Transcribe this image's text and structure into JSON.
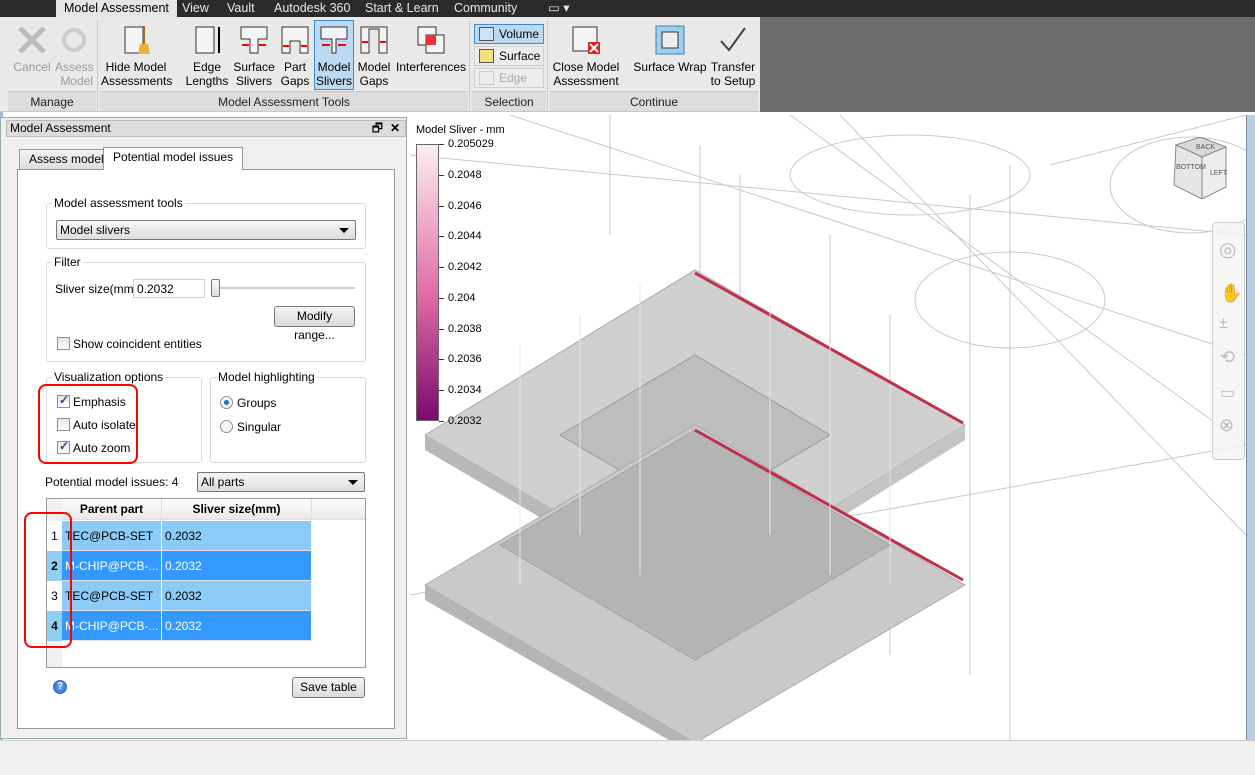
{
  "menubar": {
    "tabs": [
      "Model Assessment",
      "View",
      "Vault",
      "Autodesk 360",
      "Start & Learn",
      "Community"
    ],
    "active": "Model Assessment"
  },
  "ribbon": {
    "manage": {
      "label": "Manage",
      "cancel": "Cancel",
      "assess": [
        "Assess",
        "Model"
      ]
    },
    "tools": {
      "label": "Model Assessment Tools",
      "hide": [
        "Hide Model",
        "Assessments"
      ],
      "edge": [
        "Edge",
        "Lengths"
      ],
      "surface": [
        "Surface",
        "Slivers"
      ],
      "partgaps": [
        "Part",
        "Gaps"
      ],
      "slivers": [
        "Model",
        "Slivers"
      ],
      "modelgaps": [
        "Model",
        "Gaps"
      ],
      "interf": "Interferences"
    },
    "selection": {
      "label": "Selection",
      "volume": "Volume",
      "surface": "Surface",
      "edge": "Edge"
    },
    "cont": {
      "label": "Continue",
      "close": [
        "Close Model",
        "Assessment"
      ],
      "wrap": "Surface Wrap",
      "transfer": [
        "Transfer",
        "to Setup"
      ]
    }
  },
  "panel": {
    "title": "Model Assessment",
    "tabs": [
      "Assess model",
      "Potential model issues"
    ],
    "active_tab": "Potential model issues",
    "tools_group": "Model assessment tools",
    "tool_selected": "Model slivers",
    "filter_group": "Filter",
    "sliver_label": "Sliver size(mm)",
    "sliver_value": "0.2032",
    "slider_value_fraction": 0.0,
    "modify_range": "Modify range...",
    "show_coincident": "Show coincident entities",
    "show_coincident_checked": false,
    "vis_group": "Visualization options",
    "emphasis": "Emphasis",
    "emphasis_checked": true,
    "auto_isolate": "Auto isolate",
    "auto_isolate_checked": false,
    "auto_zoom": "Auto zoom",
    "auto_zoom_checked": true,
    "hl_group": "Model highlighting",
    "groups": "Groups",
    "singular": "Singular",
    "highlight_selected": "Groups",
    "issues_label": "Potential model issues: 4",
    "parts_filter": "All parts",
    "columns": [
      "Parent part",
      "Sliver size(mm)"
    ],
    "rows": [
      {
        "n": "1",
        "part": "TEC@PCB-SET",
        "size": "0.2032",
        "selected": false
      },
      {
        "n": "2",
        "part": "M-CHIP@PCB-...",
        "size": "0.2032",
        "selected": true
      },
      {
        "n": "3",
        "part": "TEC@PCB-SET",
        "size": "0.2032",
        "selected": false
      },
      {
        "n": "4",
        "part": "M-CHIP@PCB-...",
        "size": "0.2032",
        "selected": true
      }
    ],
    "save_table": "Save table"
  },
  "legend": {
    "title": "Model Sliver - mm",
    "ticks": [
      "0.205029",
      "0.2048",
      "0.2046",
      "0.2044",
      "0.2042",
      "0.204",
      "0.2038",
      "0.2036",
      "0.2034",
      "0.2032"
    ],
    "color_top": "#fbeef1",
    "color_bottom": "#7a0a6e"
  },
  "viewcube": {
    "faces": [
      "BACK",
      "BOTTOM",
      "LEFT"
    ]
  },
  "colors": {
    "accent": "#3d8bd0",
    "row_light": "#8ccaf7",
    "row_dark": "#3399ff",
    "sliver": "#c0304a",
    "highlight": "#ff0000"
  }
}
